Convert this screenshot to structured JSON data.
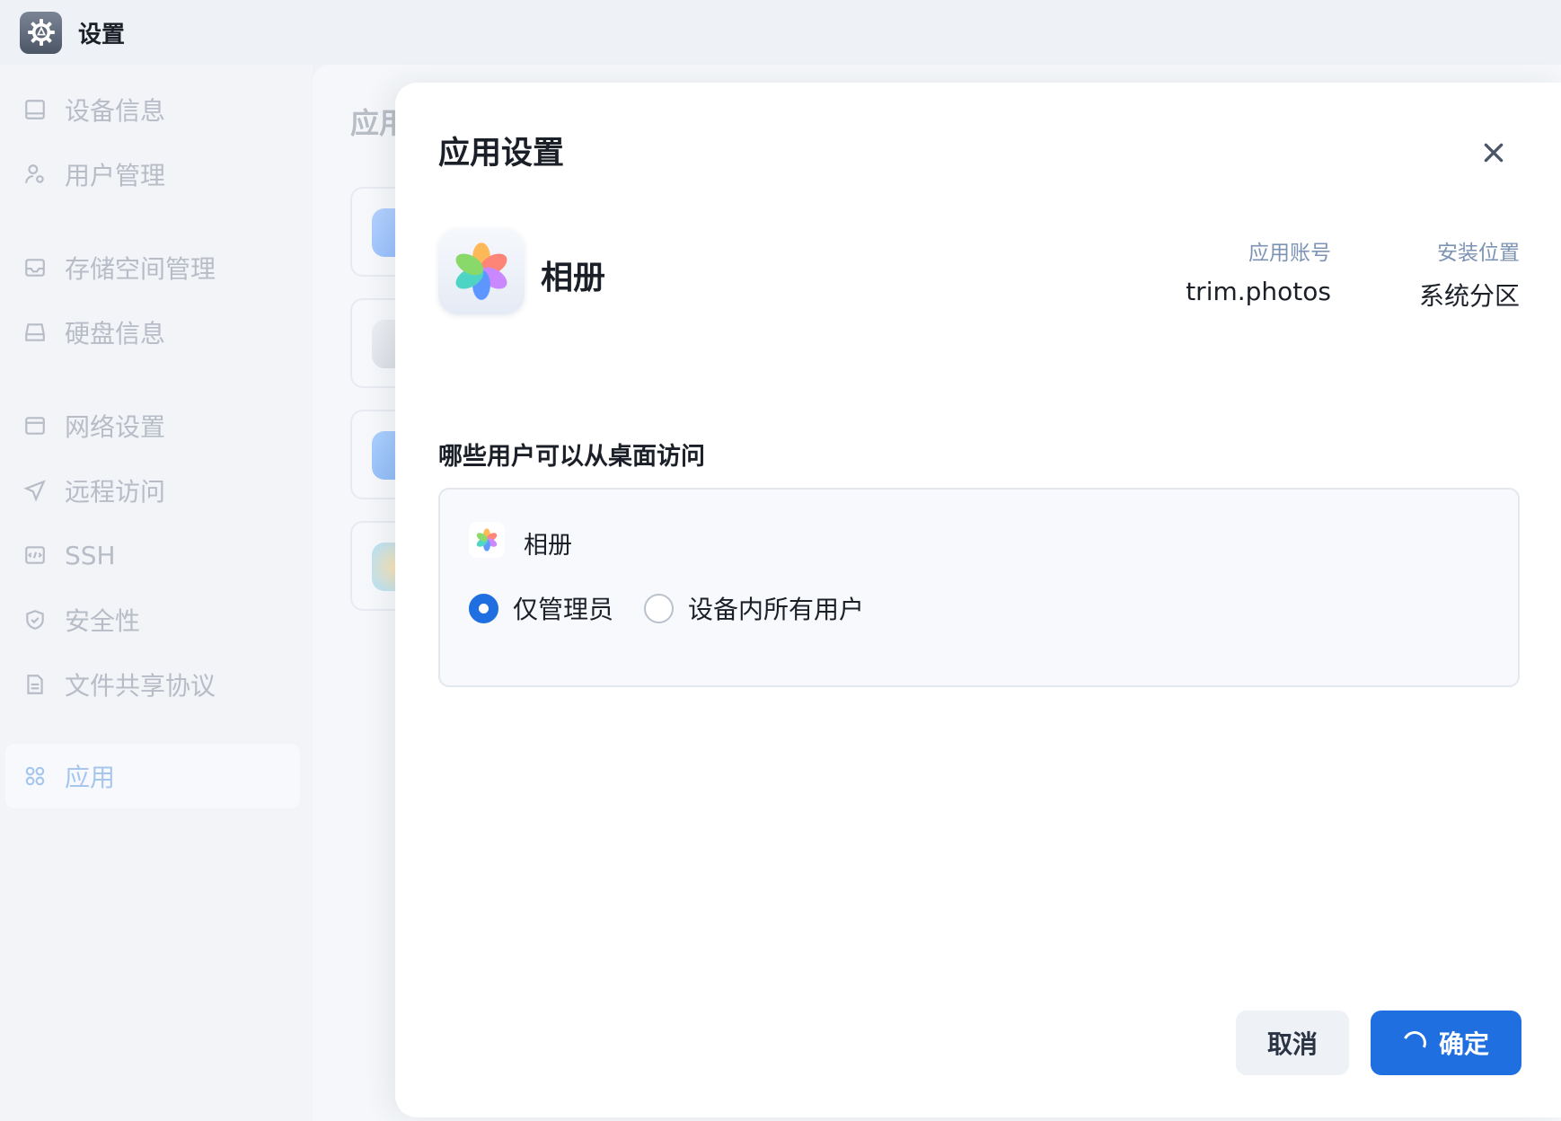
{
  "window": {
    "title": "设置",
    "icon": "gear-icon"
  },
  "sidebar": {
    "items": [
      {
        "label": "设备信息",
        "icon": "monitor-icon",
        "active": false
      },
      {
        "label": "用户管理",
        "icon": "user-settings-icon",
        "active": false
      },
      {
        "label": "存储空间管理",
        "icon": "storage-icon",
        "active": false
      },
      {
        "label": "硬盘信息",
        "icon": "disk-icon",
        "active": false
      },
      {
        "label": "网络设置",
        "icon": "network-icon",
        "active": false
      },
      {
        "label": "远程访问",
        "icon": "send-icon",
        "active": false
      },
      {
        "label": "SSH",
        "icon": "terminal-icon",
        "active": false
      },
      {
        "label": "安全性",
        "icon": "shield-icon",
        "active": false
      },
      {
        "label": "文件共享协议",
        "icon": "document-icon",
        "active": false
      },
      {
        "label": "应用",
        "icon": "apps-grid-icon",
        "active": true
      }
    ]
  },
  "background": {
    "title": "应用"
  },
  "dialog": {
    "title": "应用设置",
    "close_icon": "close-icon",
    "app": {
      "name": "相册",
      "icon": "photos-flower-icon",
      "account_label": "应用账号",
      "account_value": "trim.photos",
      "location_label": "安装位置",
      "location_value": "系统分区"
    },
    "section_label": "哪些用户可以从桌面访问",
    "access": {
      "app_name": "相册",
      "options": [
        {
          "label": "仅管理员",
          "checked": true
        },
        {
          "label": "设备内所有用户",
          "checked": false
        }
      ]
    },
    "buttons": {
      "cancel": "取消",
      "confirm": "确定"
    }
  },
  "colors": {
    "accent": "#1f6fe0",
    "muted_label": "#7d93b3",
    "sidebar_inactive": "#b7bcc6",
    "sidebar_active": "#a6c6ee"
  }
}
